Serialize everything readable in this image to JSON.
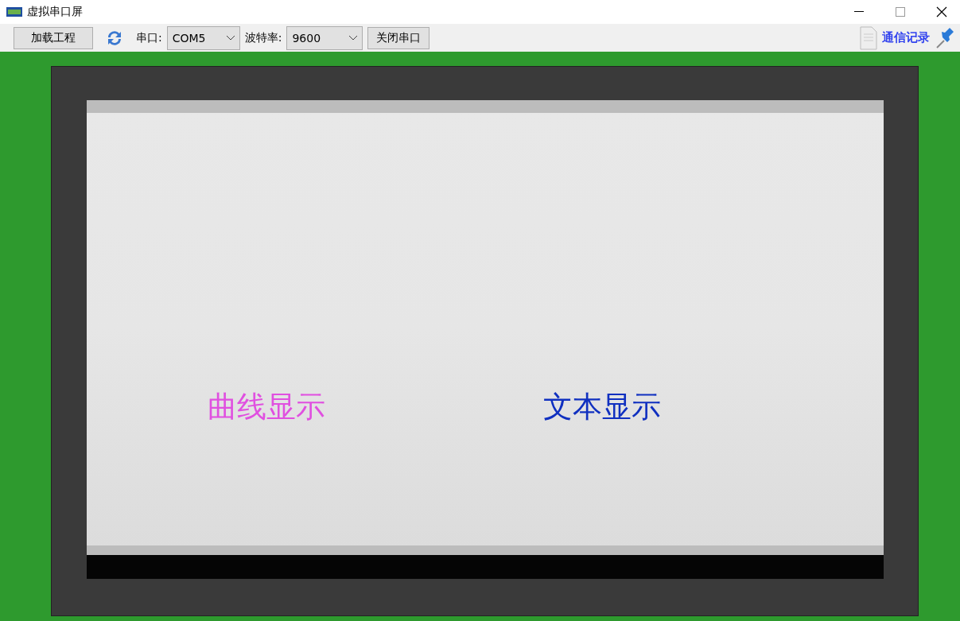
{
  "window": {
    "title": "虚拟串口屏"
  },
  "toolbar": {
    "load_button": "加载工程",
    "port": {
      "label": "串口:",
      "value": "COM5"
    },
    "baud": {
      "label": "波特率:",
      "value": "9600"
    },
    "close_port_button": "关闭串口",
    "log_link": "通信记录"
  },
  "screen": {
    "buttons": [
      {
        "label": "曲线显示",
        "color": "#e050e0"
      },
      {
        "label": "文本显示",
        "color": "#1030c0"
      }
    ]
  }
}
